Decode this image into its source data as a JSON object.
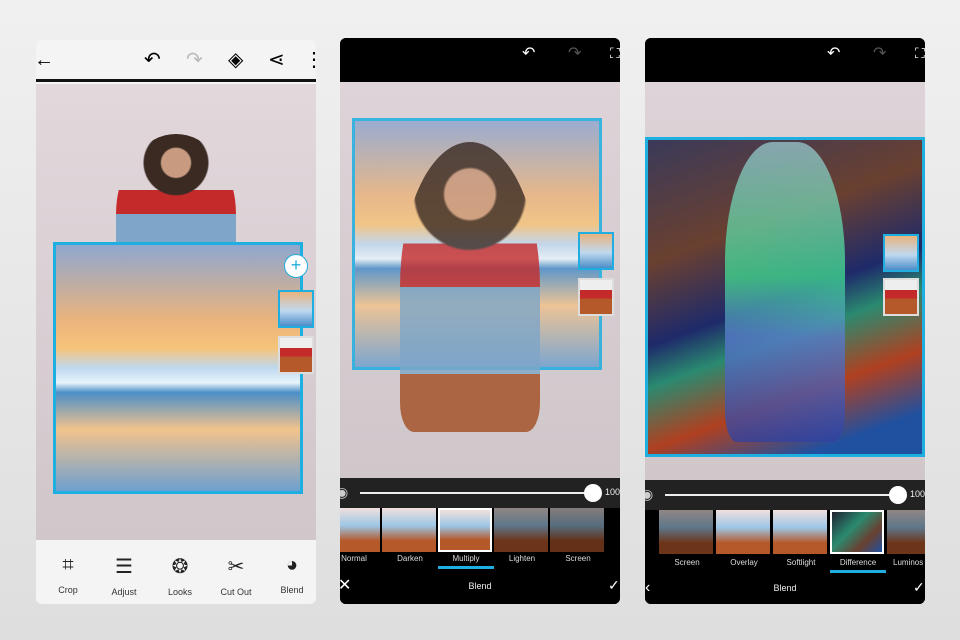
{
  "phone1": {
    "toolbar": [
      {
        "label": "Crop",
        "icon": "crop-icon",
        "glyph": "⌗"
      },
      {
        "label": "Adjust",
        "icon": "sliders-icon",
        "glyph": "☰"
      },
      {
        "label": "Looks",
        "icon": "looks-icon",
        "glyph": "❂"
      },
      {
        "label": "Cut Out",
        "icon": "scissors-icon",
        "glyph": "✂"
      },
      {
        "label": "Blend",
        "icon": "blend-icon",
        "glyph": "◕"
      }
    ],
    "add": "+"
  },
  "phone2": {
    "opacity": "100",
    "blend_modes": [
      "Normal",
      "Darken",
      "Multiply",
      "Lighten",
      "Screen"
    ],
    "selected": "Multiply",
    "footer": "Blend"
  },
  "phone3": {
    "opacity": "100",
    "blend_modes": [
      "Screen",
      "Overlay",
      "Softlight",
      "Difference",
      "Luminos"
    ],
    "selected": "Difference",
    "footer": "Blend"
  },
  "colors": {
    "accent": "#1eaee0"
  }
}
